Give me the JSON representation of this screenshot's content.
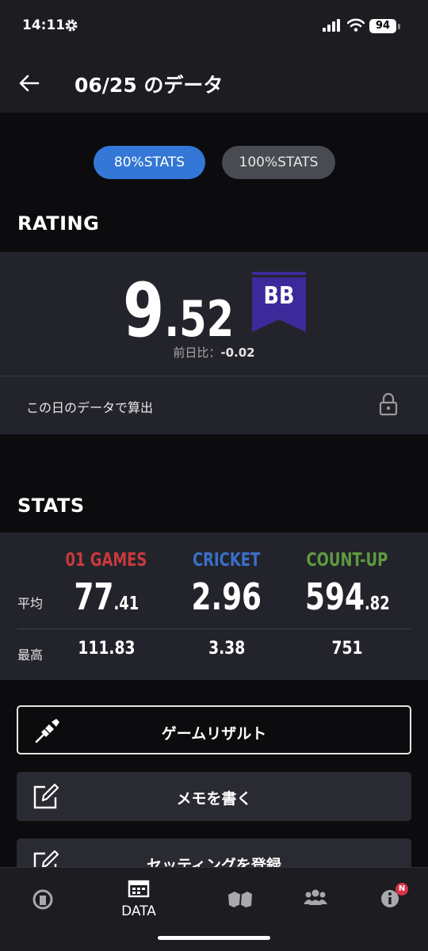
{
  "status_bar": {
    "time": "14:11",
    "battery": "94"
  },
  "header": {
    "title": "06/25 のデータ"
  },
  "stats_toggle": {
    "option_80": "80%STATS",
    "option_100": "100%STATS",
    "selected": "80%STATS"
  },
  "rating": {
    "section_title": "RATING",
    "value_integer": "9",
    "value_decimal": ".52",
    "rank": "BB",
    "prev_day_label": "前日比：",
    "prev_day_value": "-0.02",
    "calc_label": "この日のデータで算出"
  },
  "stats": {
    "section_title": "STATS",
    "row_avg_label": "平均",
    "row_max_label": "最高",
    "columns": [
      {
        "name": "01 GAMES",
        "avg_int": "77",
        "avg_dec": ".41",
        "max": "111.83",
        "color": "#c9393c"
      },
      {
        "name": "CRICKET",
        "avg_int": "2.96",
        "avg_dec": "",
        "max": "3.38",
        "color": "#3a6fc9"
      },
      {
        "name": "COUNT-UP",
        "avg_int": "594",
        "avg_dec": ".82",
        "max": "751",
        "color": "#5f9a3f"
      }
    ]
  },
  "actions": {
    "game_result": "ゲームリザルト",
    "write_memo": "メモを書く",
    "register_setting": "セッティングを登録"
  },
  "tabbar": {
    "data_label": "DATA",
    "notification_badge": "N"
  },
  "colors": {
    "accent": "#3477d6",
    "rank_badge": "#3d2a9a",
    "background": "#0c0c0f",
    "panel": "#23242b"
  }
}
